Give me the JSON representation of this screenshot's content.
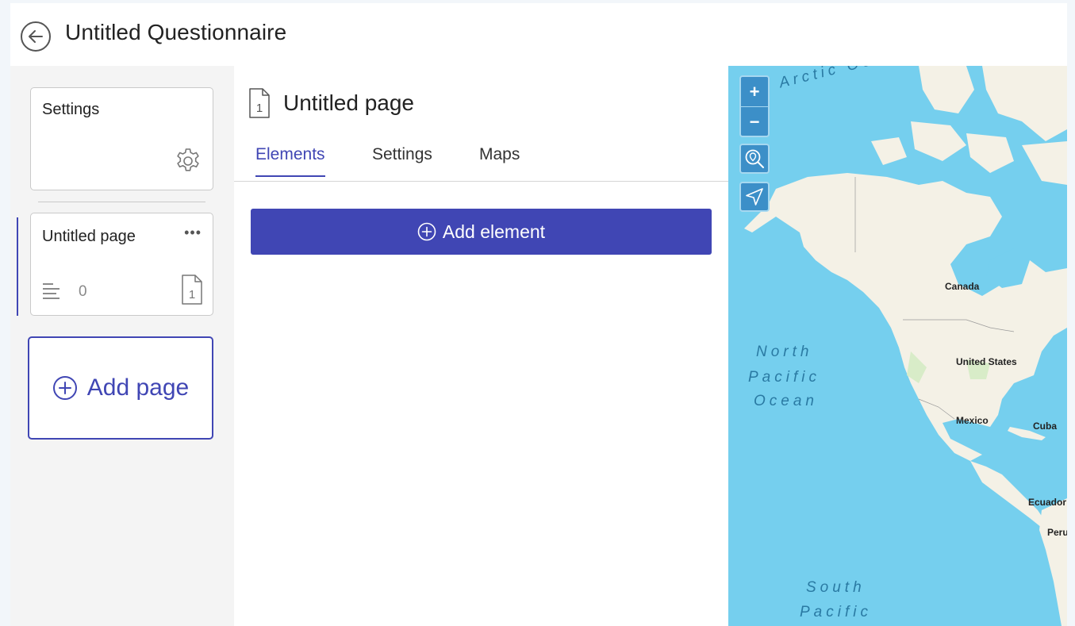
{
  "header": {
    "title": "Untitled Questionnaire"
  },
  "sidebar": {
    "settings_card": {
      "label": "Settings"
    },
    "pages": [
      {
        "label": "Untitled page",
        "more": "•••",
        "element_count": "0",
        "page_number": "1"
      }
    ],
    "add_page_label": "Add page"
  },
  "main": {
    "page_title": "Untitled page",
    "page_number": "1",
    "tabs": [
      {
        "label": "Elements",
        "active": true
      },
      {
        "label": "Settings",
        "active": false
      },
      {
        "label": "Maps",
        "active": false
      }
    ],
    "add_element_label": "Add element"
  },
  "map": {
    "zoom_in": "+",
    "zoom_out": "−",
    "countries": [
      "Canada",
      "United States",
      "Mexico",
      "Cuba",
      "Ecuador",
      "Peru"
    ],
    "oceans": {
      "arctic": "Arctic Ocean",
      "north_pacific_1": "North",
      "north_pacific_2": "Pacific",
      "north_pacific_3": "Ocean",
      "south_pacific_1": "South",
      "south_pacific_2": "Pacific"
    }
  },
  "colors": {
    "accent": "#4046b4",
    "map_water": "#75cfee",
    "map_land": "#f4f1e6",
    "map_control": "#3c8fc8"
  },
  "icons": {
    "back": "arrow-left-circle-icon",
    "settings": "gear-icon",
    "more": "ellipsis-icon",
    "elements": "lines-icon",
    "page": "page-number-icon",
    "add": "plus-circle-icon",
    "locate": "search-location-icon",
    "navigate": "navigation-arrow-icon"
  }
}
